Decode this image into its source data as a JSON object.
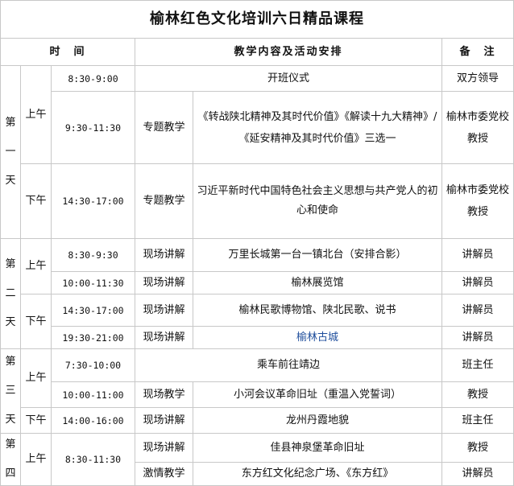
{
  "title": "榆林红色文化培训六日精品课程",
  "header": {
    "time": "时　间",
    "content": "教学内容及活动安排",
    "note": "备　注"
  },
  "days": [
    {
      "label": [
        "第",
        "一",
        "天"
      ]
    },
    {
      "label": [
        "第",
        "二",
        "天"
      ]
    },
    {
      "label": [
        "第",
        "三",
        "天"
      ]
    },
    {
      "label": [
        "第",
        "四"
      ]
    }
  ],
  "rows": [
    {
      "period": "上午",
      "time": "8:30-9:00",
      "type": "",
      "content": "开班仪式",
      "note": "双方领导"
    },
    {
      "time": "9:30-11:30",
      "type": "专题教学",
      "content": "《转战陕北精神及其时代价值》《解读十九大精神》/《延安精神及其时代价值》三选一",
      "note": "榆林市委党校教授"
    },
    {
      "period": "下午",
      "time": "14:30-17:00",
      "type": "专题教学",
      "content": "习近平新时代中国特色社会主义思想与共产党人的初心和使命",
      "note": "榆林市委党校教授"
    },
    {
      "period": "上午",
      "time": "8:30-9:30",
      "type": "现场讲解",
      "content": "万里长城第一台一镇北台（安排合影）",
      "note": "讲解员"
    },
    {
      "time": "10:00-11:30",
      "type": "现场讲解",
      "content": "榆林展览馆",
      "note": "讲解员"
    },
    {
      "period": "下午",
      "time": "14:30-17:00",
      "type": "现场讲解",
      "content": "榆林民歌博物馆、陕北民歌、说书",
      "note": "讲解员"
    },
    {
      "time": "19:30-21:00",
      "type": "现场讲解",
      "content": "榆林古城",
      "note": "讲解员"
    },
    {
      "period": "上午",
      "time": "7:30-10:00",
      "type": "",
      "content": "乘车前往靖边",
      "note": "班主任"
    },
    {
      "time": "10:00-11:00",
      "type": "现场教学",
      "content": "小河会议革命旧址（重温入党誓词）",
      "note": "教授"
    },
    {
      "period": "下午",
      "time": "14:00-16:00",
      "type": "现场讲解",
      "content": "龙州丹霞地貌",
      "note": "班主任"
    },
    {
      "period": "上午",
      "time": "8:30-11:30",
      "type": "现场讲解",
      "content": "佳县神泉堡革命旧址",
      "note": "教授"
    },
    {
      "type": "激情教学",
      "content": "东方红文化纪念广场、《东方红》",
      "note": "讲解员"
    }
  ]
}
